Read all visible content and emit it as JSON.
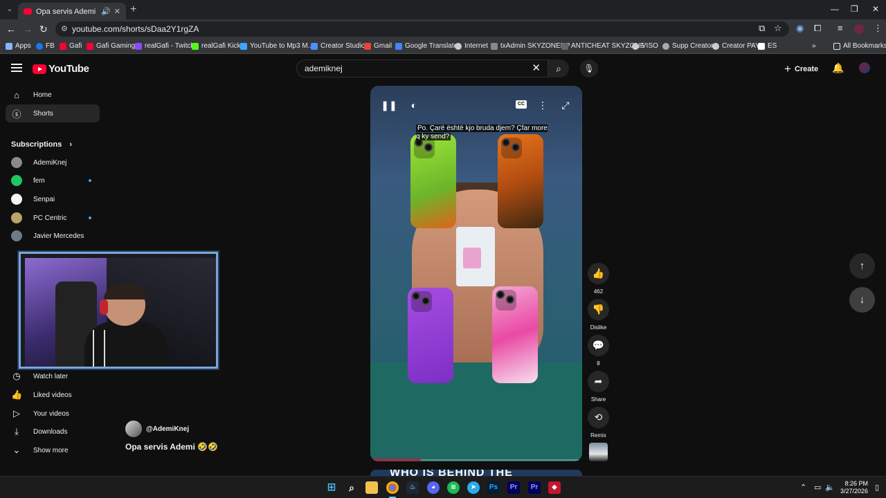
{
  "browser": {
    "tab_title": "Opa servis Ademi 🤣🤣 - Y",
    "url": "youtube.com/shorts/sDaa2Y1rgZA",
    "bookmarks": [
      {
        "label": "Apps",
        "color": "#8ab4f8"
      },
      {
        "label": "FB",
        "color": "#1877f2"
      },
      {
        "label": "Gafi",
        "color": "#ff0033"
      },
      {
        "label": "Gafi Gaming",
        "color": "#ff0033"
      },
      {
        "label": "realGafi - Twitch",
        "color": "#9146ff"
      },
      {
        "label": "realGafi Kick",
        "color": "#53fc18"
      },
      {
        "label": "YouTube to Mp3 M...",
        "color": "#3ea6ff"
      },
      {
        "label": "Creator Studio",
        "color": "#4e8cff"
      },
      {
        "label": "Gmail",
        "color": "#ea4335"
      },
      {
        "label": "Google Translate",
        "color": "#4285f4"
      },
      {
        "label": "Internet",
        "color": "#cccccc"
      },
      {
        "label": "txAdmin SKYZONERP",
        "color": "#888888"
      },
      {
        "label": "ANTICHEAT SKYZONE",
        "color": "#666666"
      },
      {
        "label": "VISO",
        "color": "#cccccc"
      },
      {
        "label": "Supp Creator",
        "color": "#aaaaaa"
      },
      {
        "label": "Creator PAY",
        "color": "#cccccc"
      },
      {
        "label": "ES",
        "color": "#ffffff"
      }
    ],
    "all_bookmarks": "All Bookmarks"
  },
  "youtube": {
    "logo": "YouTube",
    "search_value": "ademiknej",
    "create": "Create",
    "nav": [
      {
        "label": "Home",
        "icon": "home-icon"
      },
      {
        "label": "Shorts",
        "icon": "shorts-icon"
      }
    ],
    "subscriptions_heading": "Subscriptions",
    "subscriptions": [
      {
        "name": "AdemiKnej",
        "color": "#8a8a8a",
        "new": false
      },
      {
        "name": "fem",
        "color": "#22c55e",
        "new": true
      },
      {
        "name": "Senpai",
        "color": "#f5f5f5",
        "new": false
      },
      {
        "name": "PC Centric",
        "color": "#b8a36a",
        "new": true
      },
      {
        "name": "Javier Mercedes",
        "color": "#6f7a86",
        "new": false
      }
    ],
    "you_items": [
      {
        "label": "Watch later",
        "icon": "clock-icon"
      },
      {
        "label": "Liked videos",
        "icon": "thumb-up-icon"
      },
      {
        "label": "Your videos",
        "icon": "video-icon"
      },
      {
        "label": "Downloads",
        "icon": "download-icon"
      },
      {
        "label": "Show more",
        "icon": "chevron-down-icon"
      }
    ],
    "short": {
      "channel": "@AdemiKnej",
      "title": "Opa servis Ademi 🤣🤣",
      "caption": "Po. Çarë është kjo bruda djem? Çfar more q ky send?",
      "progress": 0.23,
      "next_title": "WHO IS BEHIND THE"
    },
    "actions": {
      "likes": "462",
      "dislike": "Dislike",
      "comments": "8",
      "share": "Share",
      "remix": "Remix"
    }
  },
  "taskbar": {
    "apps": [
      "Ps",
      "Pr",
      "Pr"
    ],
    "time": "8:26 PM",
    "date": "3/27/2026"
  }
}
